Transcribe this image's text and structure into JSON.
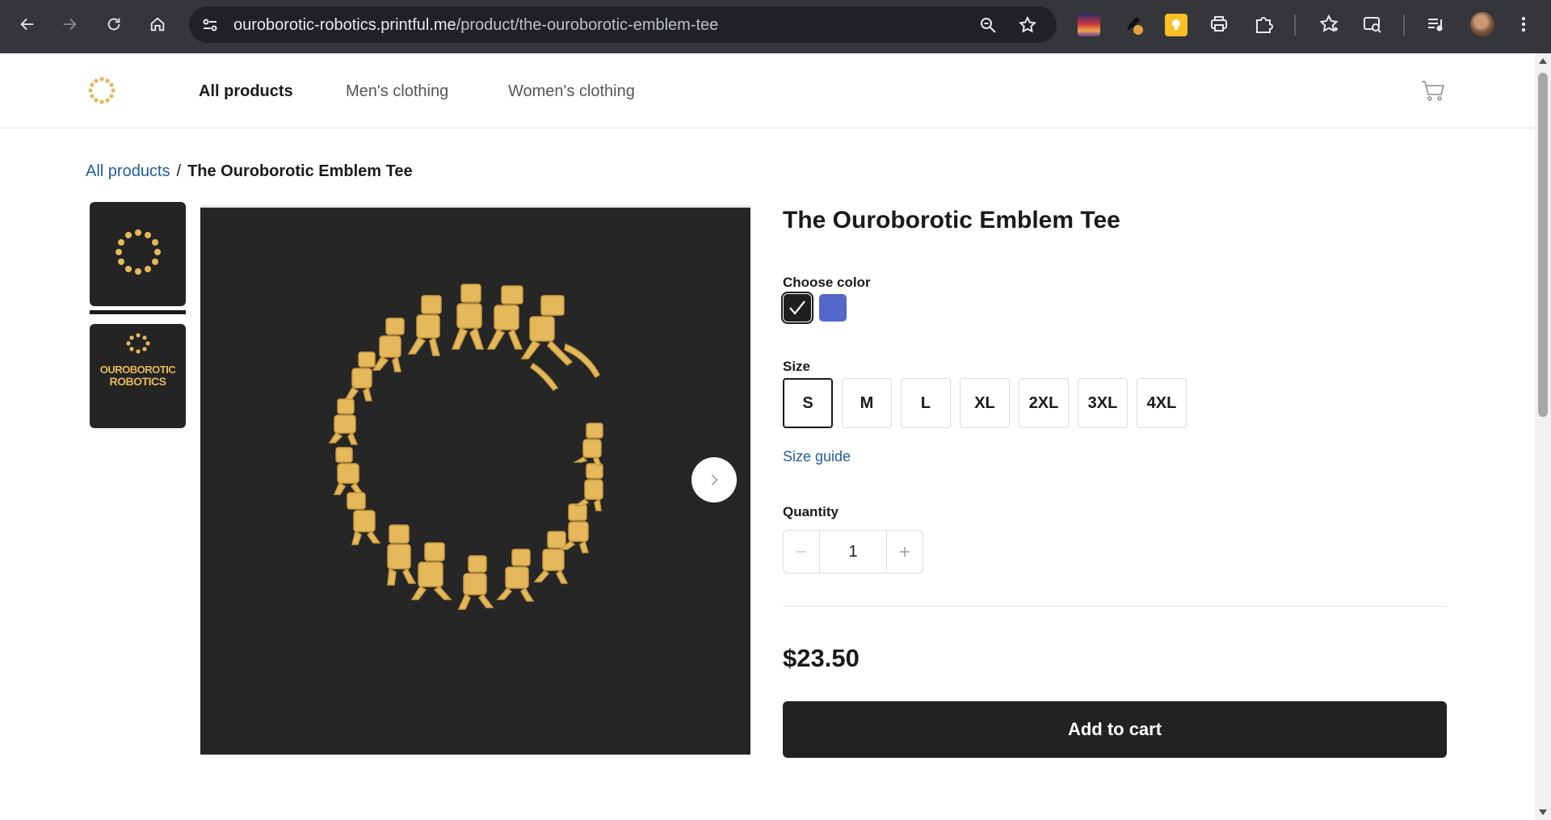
{
  "browser": {
    "url_host": "ouroborotic-robotics.printful.me",
    "url_path": "/product/the-ouroborotic-emblem-tee"
  },
  "header": {
    "nav": [
      {
        "label": "All products",
        "active": true
      },
      {
        "label": "Men's clothing",
        "active": false
      },
      {
        "label": "Women's clothing",
        "active": false
      }
    ]
  },
  "breadcrumb": {
    "parent": "All products",
    "separator": "/",
    "current": "The Ouroborotic Emblem Tee"
  },
  "gallery": {
    "thumbnail_text_line1": "OUROBOROTIC",
    "thumbnail_text_line2": "ROBOTICS"
  },
  "product": {
    "title": "The Ouroborotic Emblem Tee",
    "color_label": "Choose color",
    "colors": [
      {
        "name": "Black",
        "hex": "#1f1f1f",
        "selected": true
      },
      {
        "name": "Blue",
        "hex": "#5567c9",
        "selected": false
      }
    ],
    "size_label": "Size",
    "sizes": [
      {
        "label": "S",
        "selected": true
      },
      {
        "label": "M",
        "selected": false
      },
      {
        "label": "L",
        "selected": false
      },
      {
        "label": "XL",
        "selected": false
      },
      {
        "label": "2XL",
        "selected": false
      },
      {
        "label": "3XL",
        "selected": false
      },
      {
        "label": "4XL",
        "selected": false
      }
    ],
    "size_guide": "Size guide",
    "quantity_label": "Quantity",
    "quantity": "1",
    "price": "$23.50",
    "add_to_cart": "Add to cart"
  },
  "colors": {
    "emblem_gold": "#e6b85c",
    "link_blue": "#1d5c9c",
    "button_dark": "#222222"
  }
}
